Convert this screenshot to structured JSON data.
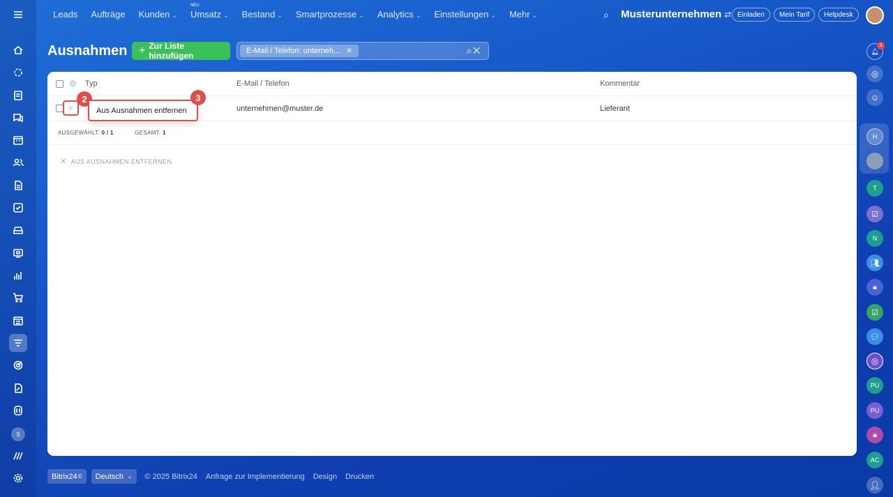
{
  "nav": {
    "items": [
      {
        "label": "Leads",
        "chevron": false
      },
      {
        "label": "Aufträge",
        "chevron": false
      },
      {
        "label": "Kunden",
        "chevron": true
      },
      {
        "label": "Umsatz",
        "chevron": true,
        "badge": "NEU"
      },
      {
        "label": "Bestand",
        "chevron": true
      },
      {
        "label": "Smartprozesse",
        "chevron": true
      },
      {
        "label": "Analytics",
        "chevron": true
      },
      {
        "label": "Einstellungen",
        "chevron": true
      },
      {
        "label": "Mehr",
        "chevron": true
      }
    ],
    "company": "Musterunternehmen",
    "invite": "Einladen",
    "tariff": "Mein Tarif",
    "helpdesk": "Helpdesk"
  },
  "page": {
    "title": "Ausnahmen",
    "add_button": "Zur Liste hinzufügen",
    "filter_tag": "E-Mail / Telefon: unterneh..."
  },
  "table": {
    "headers": {
      "type": "Typ",
      "contact": "E-Mail / Telefon",
      "comment": "Kommentar"
    },
    "rows": [
      {
        "contact": "unternehmen@muster.de",
        "comment": "Lieferant"
      }
    ],
    "context_menu_item": "Aus Ausnahmen entfernen",
    "selected_label": "AUSGEWÄHLT:",
    "selected_value": "0 / 1",
    "total_label": "GESAMT:",
    "total_value": "1",
    "bulk_action": "AUS AUSNAHMEN ENTFERNEN"
  },
  "annotations": {
    "badge_2": "2",
    "badge_3": "3"
  },
  "right_sidebar": {
    "notification_count": "3",
    "avatars": [
      "H",
      "T",
      "N",
      "PU",
      "PU",
      "AC"
    ]
  },
  "left_sidebar": {
    "avatar_letter": "S"
  },
  "footer": {
    "brand": "Bitrix24",
    "brand_mark": "©",
    "language": "Deutsch",
    "copyright": "© 2025 Bitrix24",
    "links": [
      "Anfrage zur Implementierung",
      "Design",
      "Drucken"
    ]
  },
  "colors": {
    "accent_green": "#3bc15a",
    "highlight_red": "#e0504a",
    "bg_blue": "#1758c9"
  }
}
